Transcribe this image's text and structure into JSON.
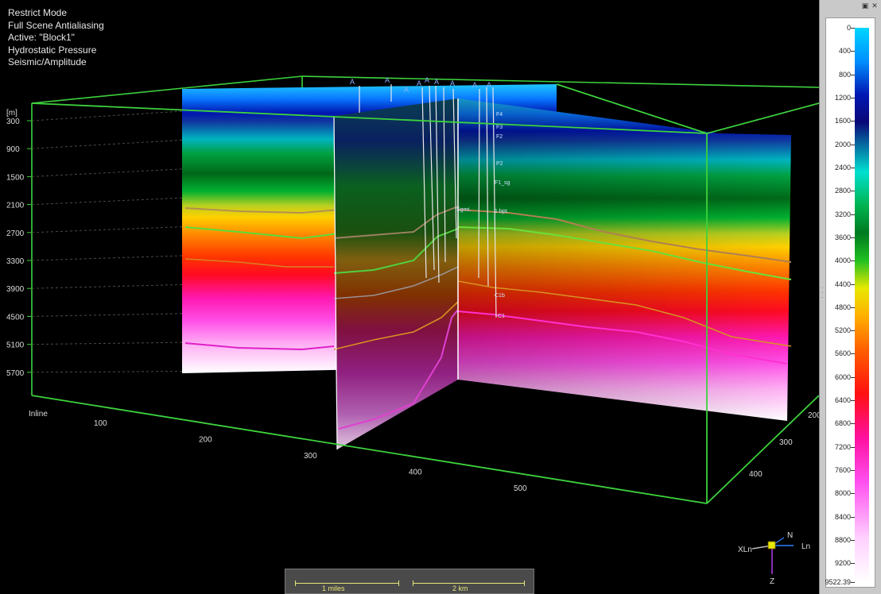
{
  "info_lines": [
    "Restrict Mode",
    "Full Scene Antialiasing",
    "Active: \"Block1\"",
    "Hydrostatic Pressure",
    "Seismic/Amplitude"
  ],
  "depth_axis": {
    "unit": "[m]",
    "ticks": [
      "300",
      "900",
      "1500",
      "2100",
      "2700",
      "3300",
      "3900",
      "4500",
      "5100",
      "5700"
    ]
  },
  "inline_axis": {
    "label": "Inline",
    "ticks": [
      "100",
      "200",
      "300",
      "400",
      "500"
    ]
  },
  "crossline_axis": {
    "ticks": [
      "200",
      "300",
      "400"
    ]
  },
  "well_tags": [
    "A",
    "A",
    "A",
    "A",
    "A",
    "A",
    "A",
    "A",
    "A"
  ],
  "marker_tags": [
    "F4",
    "F3",
    "F2",
    "P2",
    "F1_sg",
    "1 bpt.",
    "Sgmt.",
    "C1b",
    "C1"
  ],
  "colorbar": {
    "labels": [
      "0",
      "400",
      "800",
      "1200",
      "1600",
      "2000",
      "2400",
      "2800",
      "3200",
      "3600",
      "4000",
      "4400",
      "4800",
      "5200",
      "5600",
      "6000",
      "6400",
      "6800",
      "7200",
      "7600",
      "8000",
      "8400",
      "8800",
      "9200",
      "9522.39"
    ],
    "max_value": 9522.39
  },
  "panel_buttons": {
    "float": "▣",
    "close": "✕"
  },
  "scalebar": {
    "left_label": "1 miles",
    "right_label": "2 km"
  },
  "tripod": {
    "north": "N",
    "west": "XLn",
    "east": "Ln",
    "down": "Z"
  },
  "colors": {
    "box": "#3dd23d",
    "scale": "#e6e67a",
    "background": "#000000"
  }
}
